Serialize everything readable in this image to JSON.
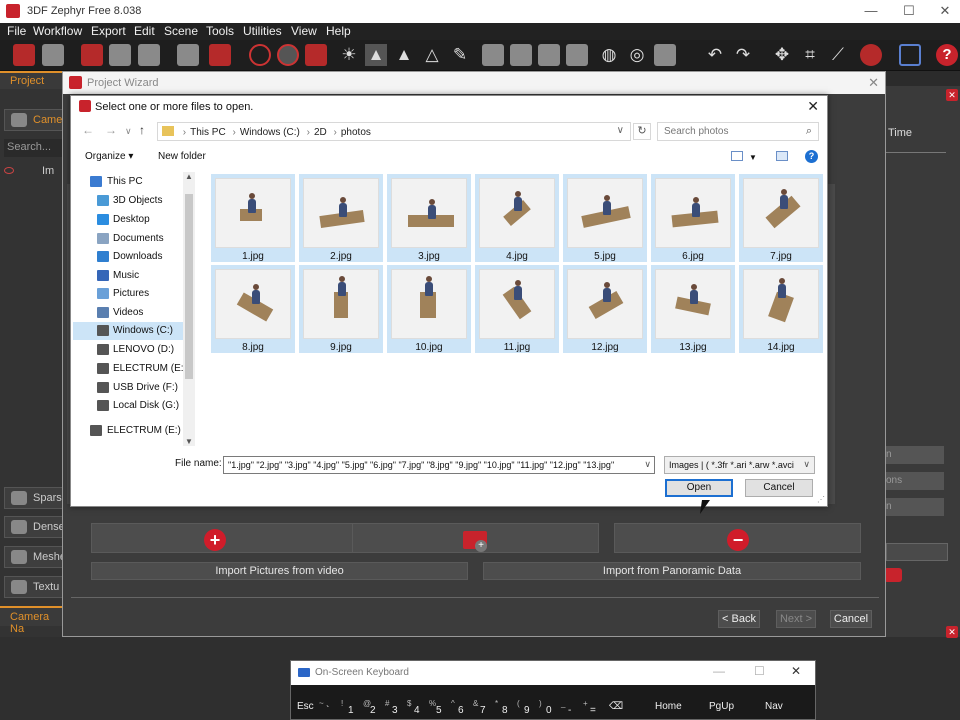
{
  "app": {
    "title": "3DF Zephyr Free 8.038",
    "menu": [
      "File",
      "Workflow",
      "Export",
      "Edit",
      "Scene",
      "Tools",
      "Utilities",
      "View",
      "Help"
    ],
    "accent": "#c8232c"
  },
  "left_panel": {
    "project_tab": "Project",
    "camera_tab": "Camer",
    "search_placeholder": "Search...",
    "row_label": "Im",
    "buttons": [
      "Spars",
      "Dense",
      "Meshe",
      "Textu"
    ],
    "bottom_tab": "Camera Na"
  },
  "right_panel": {
    "time_label": "Time",
    "buttons": [
      "n",
      "ons",
      "n"
    ]
  },
  "wizard": {
    "title": "Project Wizard",
    "import_video_label": "Import Pictures from video",
    "import_panoramic_label": "Import from Panoramic Data",
    "back_label": "< Back",
    "next_label": "Next >",
    "cancel_label": "Cancel"
  },
  "file_dialog": {
    "title": "Select one or more files to open.",
    "address": [
      "This PC",
      "Windows (C:)",
      "2D",
      "photos"
    ],
    "search_placeholder": "Search photos",
    "organize_label": "Organize",
    "new_folder_label": "New folder",
    "tree": [
      {
        "label": "This PC",
        "icon": "pc-icon",
        "root": true
      },
      {
        "label": "3D Objects",
        "icon": "cube-icon"
      },
      {
        "label": "Desktop",
        "icon": "desktop-icon"
      },
      {
        "label": "Documents",
        "icon": "documents-icon"
      },
      {
        "label": "Downloads",
        "icon": "downloads-icon"
      },
      {
        "label": "Music",
        "icon": "music-icon"
      },
      {
        "label": "Pictures",
        "icon": "pictures-icon"
      },
      {
        "label": "Videos",
        "icon": "videos-icon"
      },
      {
        "label": "Windows (C:)",
        "icon": "drive-icon",
        "selected": true
      },
      {
        "label": "LENOVO (D:)",
        "icon": "drive-icon"
      },
      {
        "label": "ELECTRUM (E:)",
        "icon": "drive-icon"
      },
      {
        "label": "USB Drive (F:)",
        "icon": "drive-icon"
      },
      {
        "label": "Local Disk (G:)",
        "icon": "drive-icon"
      },
      {
        "label": "ELECTRUM (E:)",
        "icon": "drive-icon",
        "root": true
      }
    ],
    "files": [
      "1.jpg",
      "2.jpg",
      "3.jpg",
      "4.jpg",
      "5.jpg",
      "6.jpg",
      "7.jpg",
      "8.jpg",
      "9.jpg",
      "10.jpg",
      "11.jpg",
      "12.jpg",
      "13.jpg",
      "14.jpg"
    ],
    "file_name_label": "File name:",
    "file_name_value": "\"1.jpg\" \"2.jpg\" \"3.jpg\" \"4.jpg\" \"5.jpg\" \"6.jpg\" \"7.jpg\" \"8.jpg\" \"9.jpg\" \"10.jpg\" \"11.jpg\" \"12.jpg\" \"13.jpg\"",
    "filter_value": "Images | ( *.3fr *.ari *.arw *.avci",
    "open_label": "Open",
    "cancel_label": "Cancel",
    "selection_color": "#cce4f7"
  },
  "keyboard": {
    "title": "On-Screen Keyboard",
    "keys": [
      {
        "main": "Esc"
      },
      {
        "top": "~",
        "main": "`"
      },
      {
        "top": "!",
        "main": "1"
      },
      {
        "top": "@",
        "main": "2"
      },
      {
        "top": "#",
        "main": "3"
      },
      {
        "top": "$",
        "main": "4"
      },
      {
        "top": "%",
        "main": "5"
      },
      {
        "top": "^",
        "main": "6"
      },
      {
        "top": "&",
        "main": "7"
      },
      {
        "top": "*",
        "main": "8"
      },
      {
        "top": "(",
        "main": "9"
      },
      {
        "top": ")",
        "main": "0"
      },
      {
        "top": "_",
        "main": "-"
      },
      {
        "top": "+",
        "main": "="
      },
      {
        "main": "⌫"
      },
      {
        "main": "Home"
      },
      {
        "main": "PgUp"
      },
      {
        "main": "Nav"
      }
    ]
  }
}
